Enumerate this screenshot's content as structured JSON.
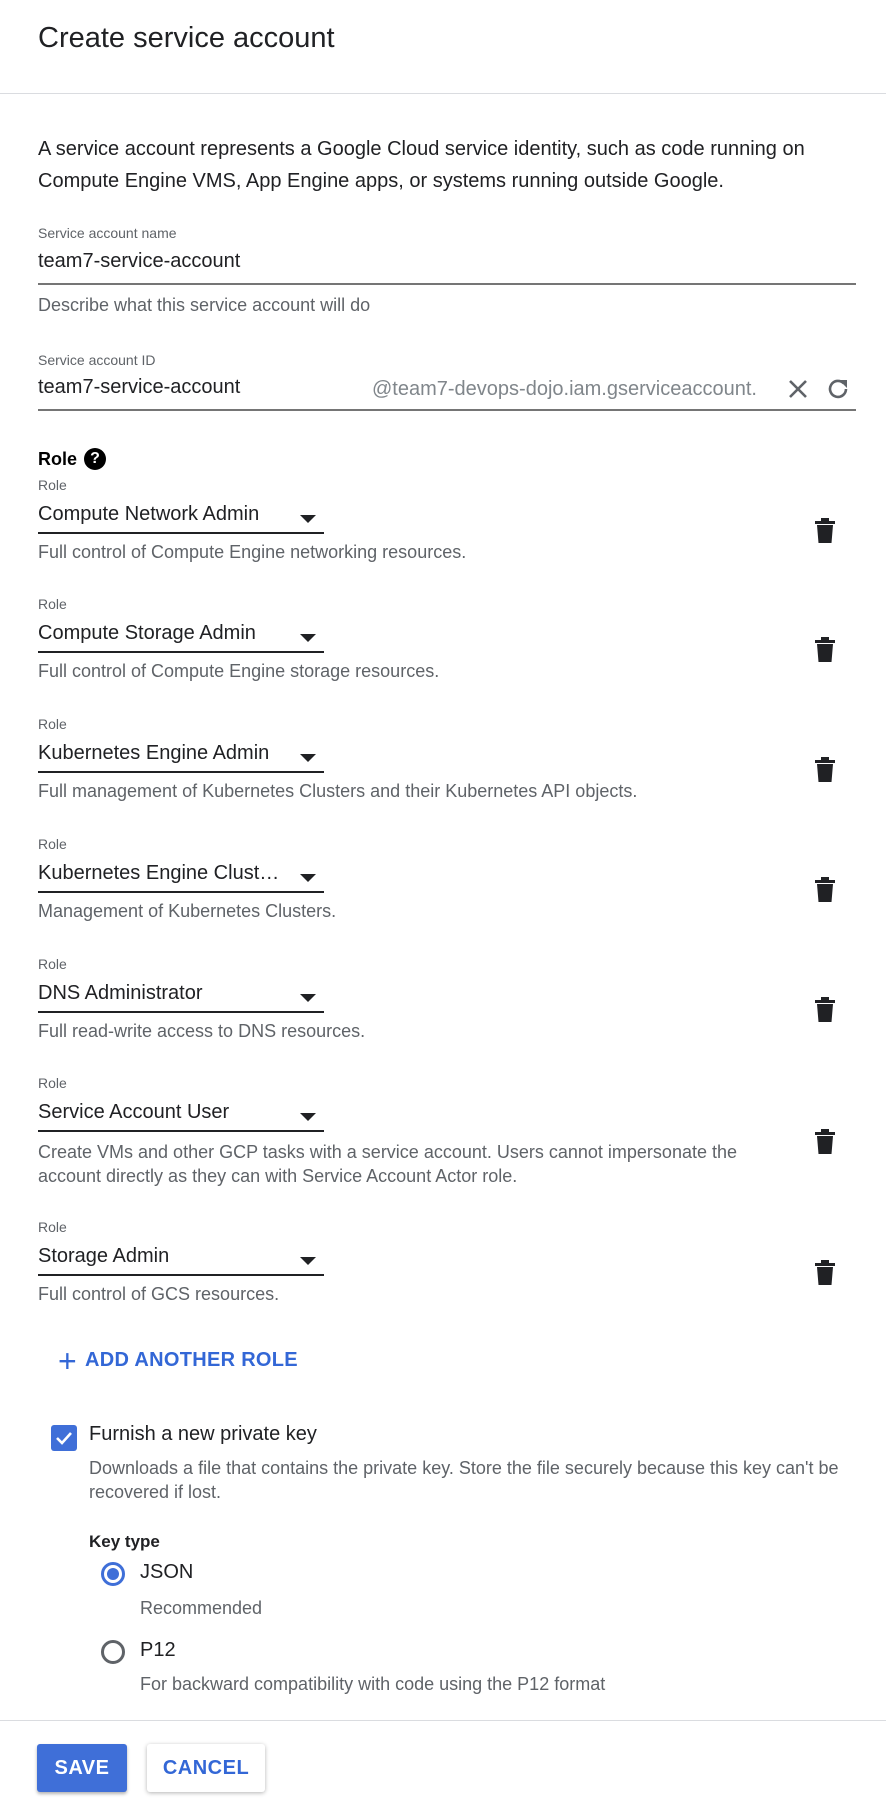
{
  "dialog": {
    "title": "Create service account",
    "intro": "A service account represents a Google Cloud service identity, such as code running on Compute Engine VMS, App Engine apps, or systems running outside Google."
  },
  "name_field": {
    "label": "Service account name",
    "value": "team7-service-account",
    "description_placeholder": "Describe what this service account will do"
  },
  "id_field": {
    "label": "Service account ID",
    "value": "team7-service-account",
    "suffix": "@team7-devops-dojo.iam.gserviceaccount.",
    "clear_icon": "close-icon",
    "refresh_icon": "refresh-icon"
  },
  "roles_section": {
    "heading": "Role",
    "help_icon": "help-icon",
    "help_glyph": "?",
    "roles": [
      {
        "label": "Role",
        "value": "Compute Network Admin",
        "description": "Full control of Compute Engine networking resources."
      },
      {
        "label": "Role",
        "value": "Compute Storage Admin",
        "description": "Full control of Compute Engine storage resources."
      },
      {
        "label": "Role",
        "value": "Kubernetes Engine Admin",
        "description": "Full management of Kubernetes Clusters and their Kubernetes API objects."
      },
      {
        "label": "Role",
        "value": "Kubernetes Engine Cluste…",
        "description": "Management of Kubernetes Clusters."
      },
      {
        "label": "Role",
        "value": "DNS Administrator",
        "description": "Full read-write access to DNS resources."
      },
      {
        "label": "Role",
        "value": "Service Account User",
        "description": "Create VMs and other GCP tasks with a service account. Users cannot impersonate the account directly as they can with Service Account Actor role."
      },
      {
        "label": "Role",
        "value": "Storage Admin",
        "description": "Full control of GCS resources."
      }
    ],
    "add_role_label": "ADD ANOTHER ROLE",
    "add_role_glyph": "+",
    "delete_icon": "trash-icon"
  },
  "private_key": {
    "checked": true,
    "label": "Furnish a new private key",
    "description": "Downloads a file that contains the private key. Store the file securely because this key can't be recovered if lost.",
    "key_type_label": "Key type",
    "options": [
      {
        "label": "JSON",
        "description": "Recommended",
        "selected": true
      },
      {
        "label": "P12",
        "description": "For backward compatibility with code using the P12 format",
        "selected": false
      }
    ]
  },
  "footer": {
    "save_label": "SAVE",
    "cancel_label": "CANCEL"
  },
  "colors": {
    "accent": "#3f6fd8",
    "link": "#3367d6",
    "muted_text": "#5f6368"
  }
}
